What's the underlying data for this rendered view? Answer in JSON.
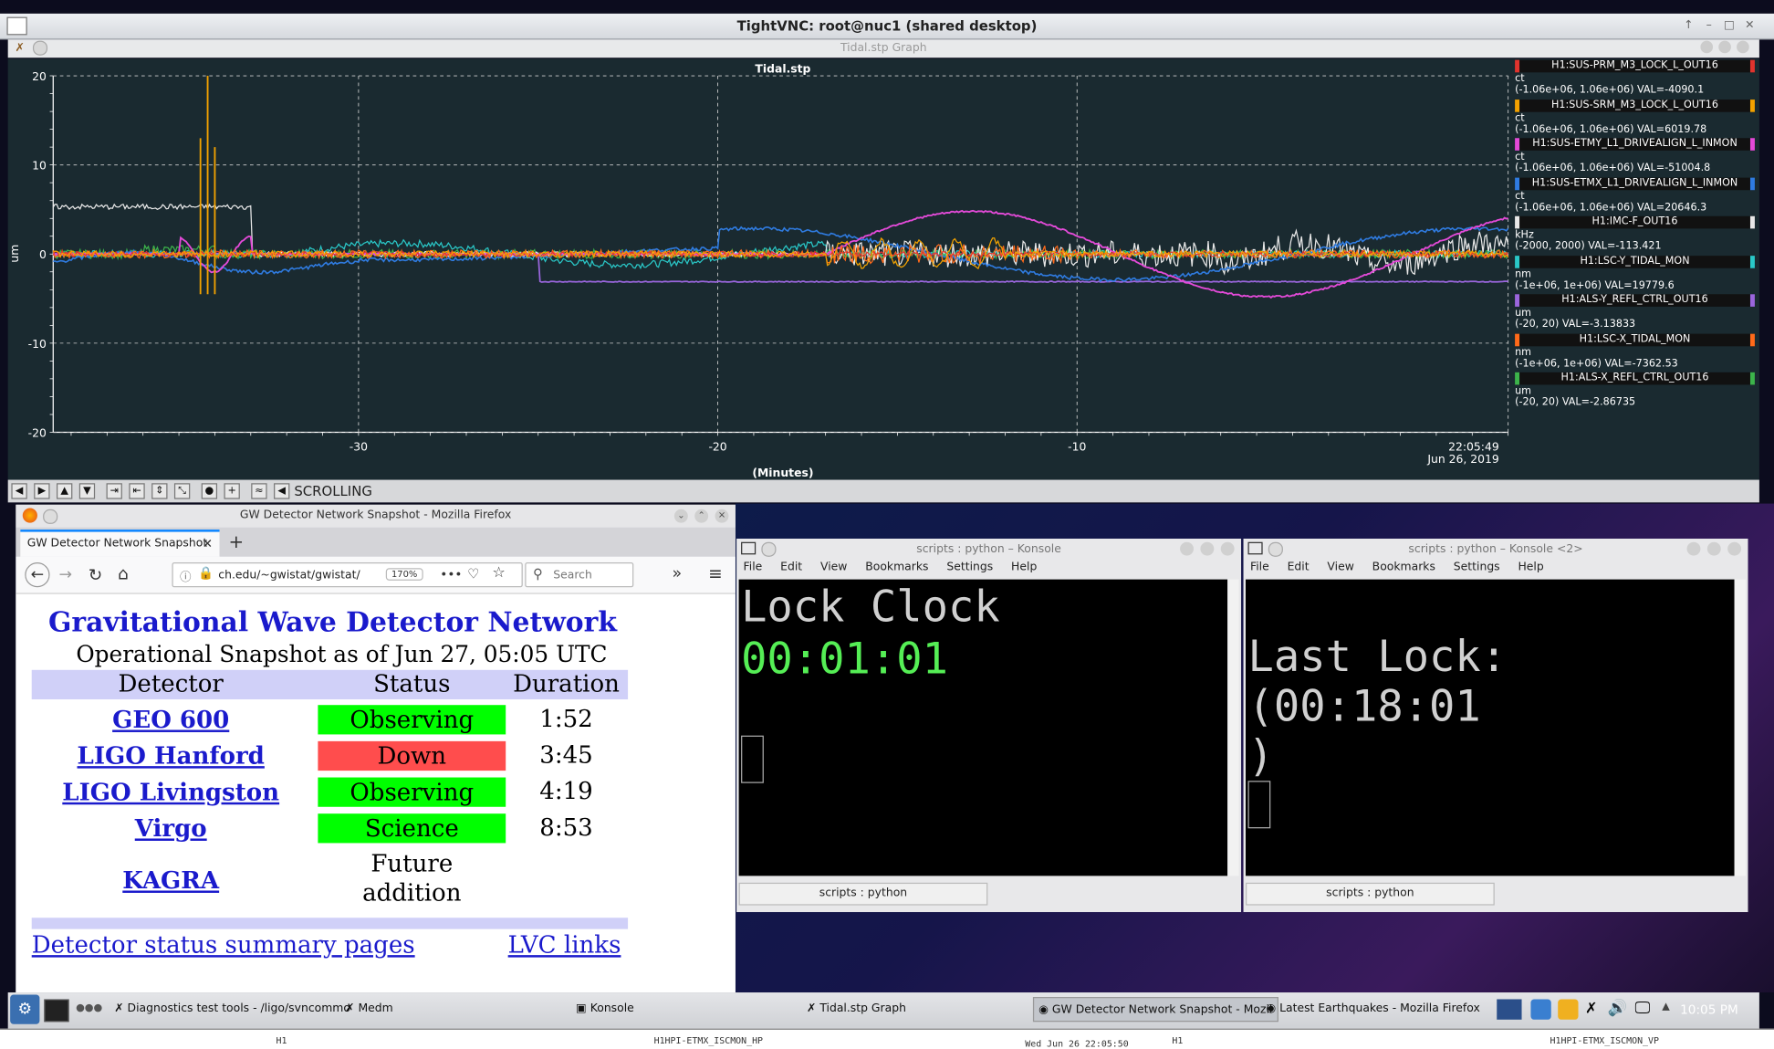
{
  "vnc": {
    "title": "TightVNC: root@nuc1 (shared desktop)"
  },
  "tidal_window": {
    "title": "Tidal.stp Graph",
    "scrolling_label": "SCROLLING"
  },
  "chart_data": {
    "type": "line",
    "title": "Tidal.stp",
    "xlabel": "(Minutes)",
    "ylabel": "um",
    "xlim": [
      -38.5,
      2
    ],
    "ylim": [
      -20,
      20
    ],
    "x_ticks": [
      "-30",
      "-20",
      "-10"
    ],
    "y_ticks": [
      "20",
      "10",
      "0",
      "-10",
      "-20"
    ],
    "timestamp": "22:05:49",
    "date": "Jun 26, 2019",
    "grid": true,
    "legend_position": "right",
    "colors": {
      "background": "#1a2a30"
    },
    "series": [
      {
        "name": "H1:SUS-PRM_M3_LOCK_L_OUT16",
        "unit": "ct",
        "range": "(-1.06e+06, 1.06e+06) VAL=-4090.1",
        "color": "#e0342e"
      },
      {
        "name": "H1:SUS-SRM_M3_LOCK_L_OUT16",
        "unit": "ct",
        "range": "(-1.06e+06, 1.06e+06) VAL=6019.78",
        "color": "#f2a200"
      },
      {
        "name": "H1:SUS-ETMY_L1_DRIVEALIGN_L_INMON",
        "unit": "ct",
        "range": "(-1.06e+06, 1.06e+06) VAL=-51004.8",
        "color": "#e34ad8"
      },
      {
        "name": "H1:SUS-ETMX_L1_DRIVEALIGN_L_INMON",
        "unit": "ct",
        "range": "(-1.06e+06, 1.06e+06) VAL=20646.3",
        "color": "#2f7be0"
      },
      {
        "name": "H1:IMC-F_OUT16",
        "unit": "kHz",
        "range": "(-2000, 2000) VAL=-113.421",
        "color": "#e8e8e8"
      },
      {
        "name": "H1:LSC-Y_TIDAL_MON",
        "unit": "nm",
        "range": "(-1e+06, 1e+06) VAL=19779.6",
        "color": "#2ac8c8"
      },
      {
        "name": "H1:ALS-Y_REFL_CTRL_OUT16",
        "unit": "um",
        "range": "(-20, 20) VAL=-3.13833",
        "color": "#9a66dd"
      },
      {
        "name": "H1:LSC-X_TIDAL_MON",
        "unit": "nm",
        "range": "(-1e+06, 1e+06) VAL=-7362.53",
        "color": "#ff6a1a"
      },
      {
        "name": "H1:ALS-X_REFL_CTRL_OUT16",
        "unit": "um",
        "range": "(-20, 20) VAL=-2.86735",
        "color": "#3cb44b"
      }
    ]
  },
  "firefox": {
    "title": "GW Detector Network Snapshot - Mozilla Firefox",
    "tab_label": "GW Detector Network Snapshot",
    "url": "ch.edu/~gwistat/gwistat/",
    "zoom": "170%",
    "search_placeholder": "Search",
    "page": {
      "heading": "Gravitational Wave Detector Network",
      "subheading": "Operational Snapshot as of Jun 27, 05:05 UTC",
      "columns": [
        "Detector",
        "Status",
        "Duration"
      ],
      "rows": [
        {
          "name": "GEO 600",
          "status": "Observing",
          "status_color": "#00ff00",
          "duration": "1:52"
        },
        {
          "name": "LIGO Hanford",
          "status": "Down",
          "status_color": "#ff4d4d",
          "duration": "3:45"
        },
        {
          "name": "LIGO Livingston",
          "status": "Observing",
          "status_color": "#00ff00",
          "duration": "4:19"
        },
        {
          "name": "Virgo",
          "status": "Science",
          "status_color": "#00ff00",
          "duration": "8:53"
        },
        {
          "name": "KAGRA",
          "status_line1": "Future",
          "status_line2": "addition",
          "duration": ""
        }
      ],
      "link_left": "Detector status summary pages",
      "link_right": "LVC links"
    }
  },
  "konsole1": {
    "title": "scripts : python – Konsole",
    "menu": [
      "File",
      "Edit",
      "View",
      "Bookmarks",
      "Settings",
      "Help"
    ],
    "line1": "Lock Clock",
    "line2": "00:01:01",
    "status_tab": "scripts : python"
  },
  "konsole2": {
    "title": "scripts : python – Konsole <2>",
    "menu": [
      "File",
      "Edit",
      "View",
      "Bookmarks",
      "Settings",
      "Help"
    ],
    "line1": "Last Lock:",
    "line2": "(00:18:01",
    "line3": ")",
    "status_tab": "scripts : python"
  },
  "taskbar": {
    "items": [
      "Diagnostics test tools - /ligo/svncommo",
      "Medm",
      "Konsole",
      "Tidal.stp Graph",
      "GW Detector Network Snapshot - Mozil",
      "Latest Earthquakes - Mozilla Firefox"
    ],
    "clock": "10:05 PM"
  },
  "bottom_strip": {
    "left_label": "H1",
    "left_channel": "H1HPI-ETMX_ISCMON_HP",
    "center_time": "Wed Jun 26 22:05:50",
    "right_label": "H1",
    "right_channel": "H1HPI-ETMX_ISCMON_VP"
  }
}
